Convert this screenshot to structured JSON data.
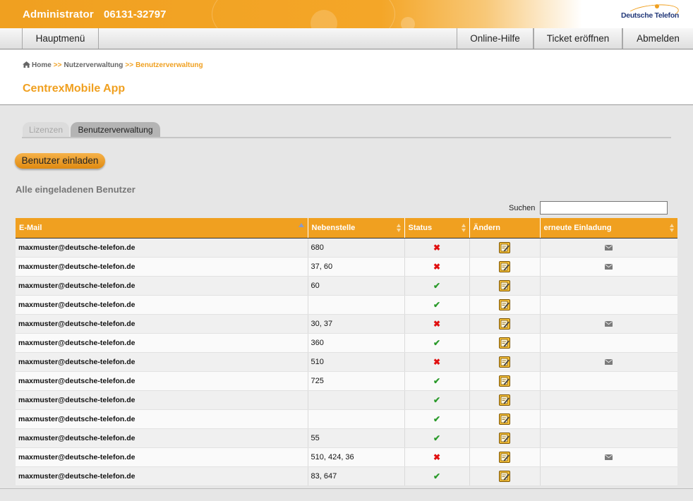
{
  "header": {
    "admin_label": "Administrator",
    "phone": "06131-32797",
    "brand": "Deutsche Telefon"
  },
  "nav": {
    "main_menu": "Hauptmenü",
    "help": "Online-Hilfe",
    "ticket": "Ticket eröffnen",
    "logout": "Abmelden"
  },
  "breadcrumb": {
    "home": "Home",
    "sep": ">>",
    "users_admin": "Nutzerverwaltung",
    "current": "Benutzerverwaltung"
  },
  "page_title": "CentrexMobile App",
  "tabs": [
    {
      "label": "Lizenzen",
      "active": false
    },
    {
      "label": "Benutzerverwaltung",
      "active": true
    }
  ],
  "invite_button": "Benutzer einladen",
  "section_title": "Alle eingeladenen Benutzer",
  "search": {
    "label": "Suchen",
    "value": ""
  },
  "table": {
    "columns": [
      "E-Mail",
      "Nebenstelle",
      "Status",
      "Ändern",
      "erneute Einladung"
    ],
    "rows": [
      {
        "email": "maxmuster@deutsche-telefon.de",
        "ext": "680",
        "status": "x",
        "reinvite": true
      },
      {
        "email": "maxmuster@deutsche-telefon.de",
        "ext": "37, 60",
        "status": "x",
        "reinvite": true
      },
      {
        "email": "maxmuster@deutsche-telefon.de",
        "ext": "60",
        "status": "check",
        "reinvite": false
      },
      {
        "email": "maxmuster@deutsche-telefon.de",
        "ext": "",
        "status": "check",
        "reinvite": false
      },
      {
        "email": "maxmuster@deutsche-telefon.de",
        "ext": "30, 37",
        "status": "x",
        "reinvite": true
      },
      {
        "email": "maxmuster@deutsche-telefon.de",
        "ext": "360",
        "status": "check",
        "reinvite": false
      },
      {
        "email": "maxmuster@deutsche-telefon.de",
        "ext": "510",
        "status": "x",
        "reinvite": true
      },
      {
        "email": "maxmuster@deutsche-telefon.de",
        "ext": "725",
        "status": "check",
        "reinvite": false
      },
      {
        "email": "maxmuster@deutsche-telefon.de",
        "ext": "",
        "status": "check",
        "reinvite": false
      },
      {
        "email": "maxmuster@deutsche-telefon.de",
        "ext": "",
        "status": "check",
        "reinvite": false
      },
      {
        "email": "maxmuster@deutsche-telefon.de",
        "ext": "55",
        "status": "check",
        "reinvite": false
      },
      {
        "email": "maxmuster@deutsche-telefon.de",
        "ext": "510, 424, 36",
        "status": "x",
        "reinvite": true
      },
      {
        "email": "maxmuster@deutsche-telefon.de",
        "ext": "83, 647",
        "status": "check",
        "reinvite": false
      }
    ]
  },
  "icons": {
    "status_failed": "x-icon",
    "status_ok": "check-icon",
    "edit": "edit-icon",
    "reinvite": "mail-icon"
  },
  "colors": {
    "accent": "#f0a020",
    "brand_blue": "#243a7a",
    "status_failed": "#e01010",
    "status_ok": "#2a9a2a"
  }
}
